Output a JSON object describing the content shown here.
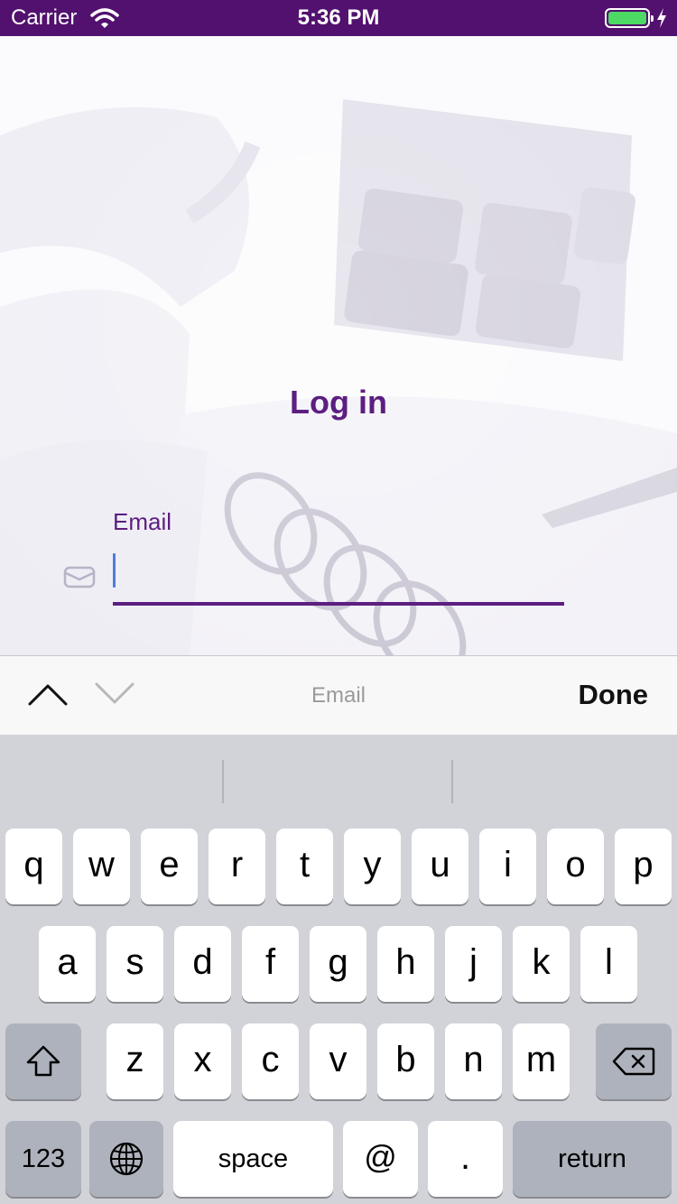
{
  "status_bar": {
    "carrier": "Carrier",
    "time": "5:36 PM",
    "battery_level": 1.0
  },
  "login": {
    "title": "Log in",
    "email_label": "Email",
    "email_value": ""
  },
  "toolbar": {
    "title": "Email",
    "done_label": "Done"
  },
  "keyboard": {
    "row1": [
      "q",
      "w",
      "e",
      "r",
      "t",
      "y",
      "u",
      "i",
      "o",
      "p"
    ],
    "row2": [
      "a",
      "s",
      "d",
      "f",
      "g",
      "h",
      "j",
      "k",
      "l"
    ],
    "row3": [
      "z",
      "x",
      "c",
      "v",
      "b",
      "n",
      "m"
    ],
    "numbers_label": "123",
    "space_label": "space",
    "at_label": "@",
    "dot_label": ".",
    "return_label": "return"
  },
  "colors": {
    "status_bar": "#52116e",
    "accent": "#5c1e80",
    "caret": "#4f7bdc"
  },
  "icons": [
    "wifi-icon",
    "battery-icon",
    "bolt-icon",
    "mail-icon",
    "chevron-up-icon",
    "chevron-down-icon",
    "shift-icon",
    "globe-icon",
    "backspace-icon"
  ]
}
